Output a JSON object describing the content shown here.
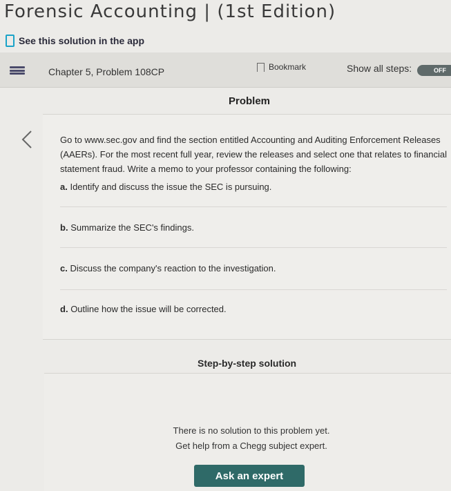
{
  "header": {
    "title": "Forensic Accounting | (1st Edition)",
    "see_app": "See this solution in the app"
  },
  "chapter_bar": {
    "chapter": "Chapter 5, Problem 108CP",
    "bookmark": "Bookmark",
    "show_steps": "Show all steps:",
    "toggle": "OFF"
  },
  "problem": {
    "heading": "Problem",
    "text": "Go to www.sec.gov and find the section entitled Accounting and Auditing Enforcement Releases (AAERs). For the most recent full year, review the releases and select one that relates to financial statement fraud. Write a memo to your professor containing the following:",
    "parts": [
      {
        "letter": "a.",
        "text": "Identify and discuss the issue the SEC is pursuing."
      },
      {
        "letter": "b.",
        "text": "Summarize the SEC's findings."
      },
      {
        "letter": "c.",
        "text": "Discuss the company's reaction to the investigation."
      },
      {
        "letter": "d.",
        "text": "Outline how the issue will be corrected."
      }
    ]
  },
  "solution": {
    "heading": "Step-by-step solution",
    "no_solution_line1": "There is no solution to this problem yet.",
    "no_solution_line2": "Get help from a Chegg subject expert.",
    "button": "Ask an expert"
  },
  "icons": {
    "menu": "menu-icon",
    "phone": "phone-icon",
    "bookmark": "bookmark-icon",
    "back": "chevron-left-icon"
  },
  "colors": {
    "accent": "#1aa3c8",
    "button": "#2f6a68",
    "toggle": "#5f6a6a"
  }
}
